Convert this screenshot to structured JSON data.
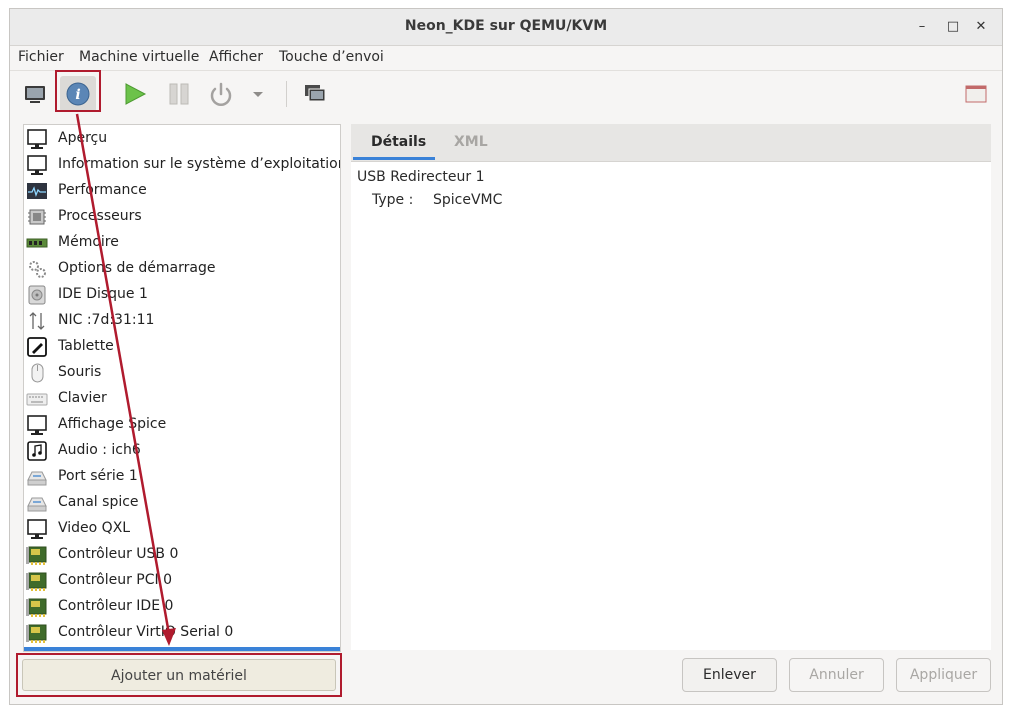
{
  "window": {
    "title": "Neon_KDE sur QEMU/KVM"
  },
  "menubar": [
    "Fichier",
    "Machine virtuelle",
    "Afficher",
    "Touche d’envoi"
  ],
  "hardware_list": [
    {
      "label": "Aperçu",
      "icon": "monitor-icon"
    },
    {
      "label": "Information sur le système d’exploitation",
      "icon": "monitor-icon"
    },
    {
      "label": "Performance",
      "icon": "performance-graph-icon"
    },
    {
      "label": "Processeurs",
      "icon": "cpu-chip-icon"
    },
    {
      "label": "Mémoire",
      "icon": "memory-module-icon"
    },
    {
      "label": "Options de démarrage",
      "icon": "gears-icon"
    },
    {
      "label": "IDE Disque 1",
      "icon": "disk-icon"
    },
    {
      "label": "NIC :7d:31:11",
      "icon": "network-arrows-icon"
    },
    {
      "label": "Tablette",
      "icon": "tablet-icon"
    },
    {
      "label": "Souris",
      "icon": "mouse-icon"
    },
    {
      "label": "Clavier",
      "icon": "keyboard-icon"
    },
    {
      "label": "Affichage Spice",
      "icon": "monitor-icon"
    },
    {
      "label": "Audio : ich6",
      "icon": "audio-note-icon"
    },
    {
      "label": "Port série 1",
      "icon": "serial-port-icon"
    },
    {
      "label": "Canal spice",
      "icon": "serial-port-icon"
    },
    {
      "label": "Video QXL",
      "icon": "monitor-icon"
    },
    {
      "label": "Contrôleur USB 0",
      "icon": "controller-card-icon"
    },
    {
      "label": "Contrôleur PCI 0",
      "icon": "controller-card-icon"
    },
    {
      "label": "Contrôleur IDE 0",
      "icon": "controller-card-icon"
    },
    {
      "label": "Contrôleur VirtIO Serial 0",
      "icon": "controller-card-icon"
    }
  ],
  "tabs": {
    "details": "Détails",
    "xml": "XML"
  },
  "details": {
    "device_title": "USB Redirecteur 1",
    "type_label": "Type :",
    "type_value": "SpiceVMC"
  },
  "buttons": {
    "add_hardware": "Ajouter un matériel",
    "remove": "Enlever",
    "cancel": "Annuler",
    "apply": "Appliquer"
  },
  "colors": {
    "annotation": "#b01b2e",
    "selection": "#3a82d8",
    "play": "#4caf2a"
  }
}
